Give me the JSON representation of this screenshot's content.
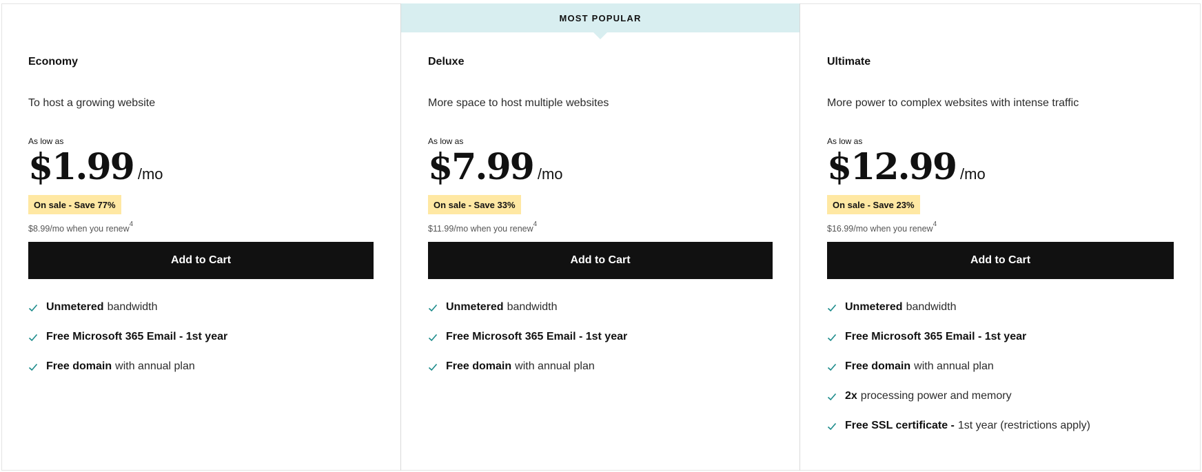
{
  "ribbon": {
    "label": "MOST POPULAR"
  },
  "colors": {
    "ribbon_bg": "#d8eef0",
    "sale_bg": "#ffe8a3",
    "check": "#1a8a8a",
    "button_bg": "#111111"
  },
  "plans": [
    {
      "name": "Economy",
      "description": "To host a growing website",
      "as_low_as": "As low as",
      "price": "$1.99",
      "per": "/mo",
      "sale": "On sale - Save 77%",
      "renew": "$8.99/mo when you renew",
      "renew_note": "4",
      "cta": "Add to Cart",
      "features": [
        {
          "bold": "Unmetered",
          "rest": "bandwidth"
        },
        {
          "bold": "Free Microsoft 365 Email - 1st year",
          "rest": ""
        },
        {
          "bold": "Free domain",
          "rest": "with annual plan"
        }
      ]
    },
    {
      "name": "Deluxe",
      "description": "More space to host multiple websites",
      "as_low_as": "As low as",
      "price": "$7.99",
      "per": "/mo",
      "sale": "On sale - Save 33%",
      "renew": "$11.99/mo when you renew",
      "renew_note": "4",
      "cta": "Add to Cart",
      "features": [
        {
          "bold": "Unmetered",
          "rest": "bandwidth"
        },
        {
          "bold": "Free Microsoft 365 Email - 1st year",
          "rest": ""
        },
        {
          "bold": "Free domain",
          "rest": "with annual plan"
        }
      ]
    },
    {
      "name": "Ultimate",
      "description": "More power to complex websites with intense traffic",
      "as_low_as": "As low as",
      "price": "$12.99",
      "per": "/mo",
      "sale": "On sale - Save 23%",
      "renew": "$16.99/mo when you renew",
      "renew_note": "4",
      "cta": "Add to Cart",
      "features": [
        {
          "bold": "Unmetered",
          "rest": "bandwidth"
        },
        {
          "bold": "Free Microsoft 365 Email - 1st year",
          "rest": ""
        },
        {
          "bold": "Free domain",
          "rest": "with annual plan"
        },
        {
          "bold": "2x",
          "rest": "processing power and memory"
        },
        {
          "bold": "Free SSL certificate -",
          "rest": "1st year (restrictions apply)"
        }
      ]
    }
  ]
}
